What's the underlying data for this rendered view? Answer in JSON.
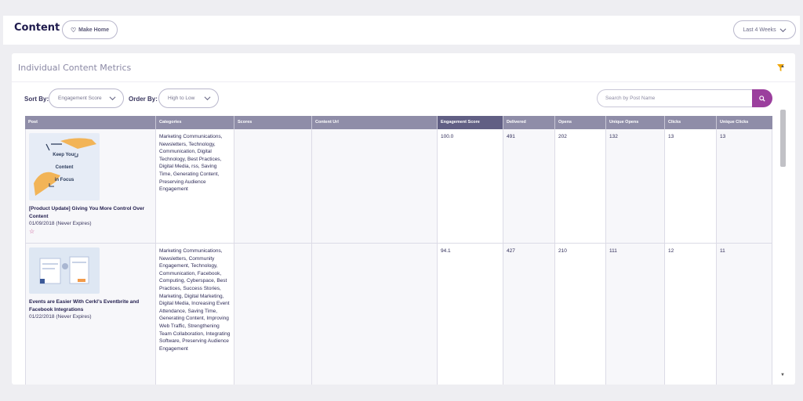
{
  "header": {
    "title": "Content",
    "make_home": "Make Home",
    "date_range": "Last 4 Weeks"
  },
  "panel": {
    "title": "Individual Content Metrics",
    "sort_by_label": "Sort By:",
    "sort_by_value": "Engagement Score",
    "order_by_label": "Order By:",
    "order_by_value": "High to Low",
    "search_placeholder": "Search by Post Name"
  },
  "table": {
    "columns": [
      "Post",
      "Categories",
      "Scores",
      "Content Url",
      "Engagement Score",
      "Delivered",
      "Opens",
      "Unique Opens",
      "Clicks",
      "Unique Clicks"
    ],
    "rows": [
      {
        "thumb_lines": [
          "Keep Your",
          "Content",
          "in Focus"
        ],
        "title": "[Product Update] Giving You More Control Over Content",
        "date": "01/09/2018 (Never Expires)",
        "categories": "Marketing Communications, Newsletters, Technology, Communication, Digital Technology, Best Practices, Digital Media, rss, Saving Time, Generating Content, Preserving Audience Engagement",
        "scores": "",
        "content_url": "",
        "engagement_score": "100.0",
        "delivered": "491",
        "opens": "202",
        "unique_opens": "132",
        "clicks": "13",
        "unique_clicks": "13"
      },
      {
        "thumb_lines": [],
        "title": "Events are Easier With Cerkl's Eventbrite and Facebook Integrations",
        "date": "01/22/2018 (Never Expires)",
        "categories": "Marketing Communications, Newsletters, Community Engagement, Technology, Communication, Facebook, Computing, Cyberspace, Best Practices, Success Stories, Marketing, Digital Marketing, Digital Media, Increasing Event Attendance, Saving Time, Generating Content, Improving Web Traffic, Strengthening Team Collaboration, Integrating Software, Preserving Audience Engagement",
        "scores": "",
        "content_url": "",
        "engagement_score": "94.1",
        "delivered": "427",
        "opens": "210",
        "unique_opens": "111",
        "clicks": "12",
        "unique_clicks": "11"
      }
    ]
  },
  "colors": {
    "accent": "#9b3f9d",
    "header_bg": "#8f8da8",
    "active_header_bg": "#615f84",
    "filter_icon": "#f0a500",
    "star": "#c13e86"
  },
  "icons": [
    "heart-icon",
    "chevron-down-icon",
    "filter-icon",
    "search-icon",
    "star-icon"
  ]
}
